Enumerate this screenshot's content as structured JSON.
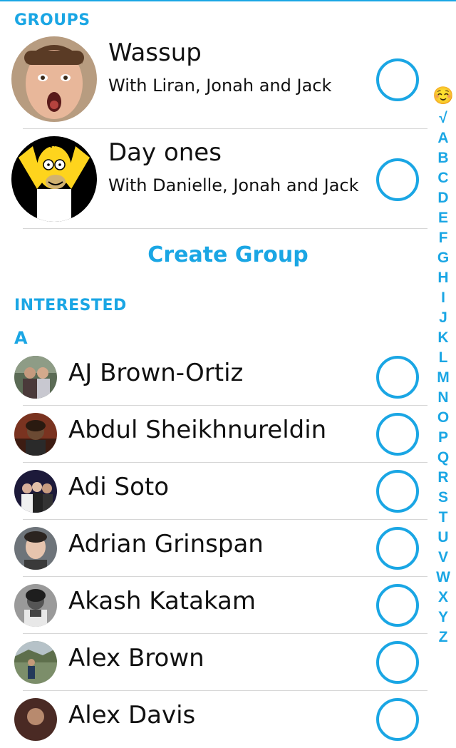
{
  "sections": {
    "groups": "GROUPS",
    "interested": "INTERESTED",
    "letter_a": "A"
  },
  "groups": [
    {
      "name": "Wassup",
      "members": "With Liran, Jonah and Jack"
    },
    {
      "name": "Day ones",
      "members": "With Danielle, Jonah and Jack"
    }
  ],
  "create_group_label": "Create Group",
  "contacts": [
    {
      "name": "AJ Brown-Ortiz"
    },
    {
      "name": "Abdul Sheikhnureldin"
    },
    {
      "name": "Adi Soto"
    },
    {
      "name": "Adrian Grinspan"
    },
    {
      "name": "Akash Katakam"
    },
    {
      "name": "Alex Brown"
    },
    {
      "name": "Alex Davis"
    }
  ],
  "index": {
    "emoji": "☺️",
    "letters": [
      "√",
      "A",
      "B",
      "C",
      "D",
      "E",
      "F",
      "G",
      "H",
      "I",
      "J",
      "K",
      "L",
      "M",
      "N",
      "O",
      "P",
      "Q",
      "R",
      "S",
      "T",
      "U",
      "V",
      "W",
      "X",
      "Y",
      "Z"
    ]
  },
  "colors": {
    "accent": "#1aa6e4",
    "text": "#111111",
    "divider": "#d6d6d6"
  }
}
